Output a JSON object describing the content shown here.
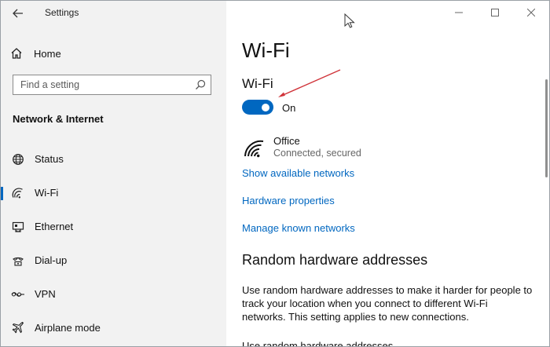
{
  "window": {
    "title": "Settings"
  },
  "sidebar": {
    "home_label": "Home",
    "search_placeholder": "Find a setting",
    "section_heading": "Network & Internet",
    "items": [
      {
        "label": "Status",
        "icon": "globe-icon",
        "active": false
      },
      {
        "label": "Wi-Fi",
        "icon": "wifi-icon",
        "active": true
      },
      {
        "label": "Ethernet",
        "icon": "ethernet-icon",
        "active": false
      },
      {
        "label": "Dial-up",
        "icon": "dialup-icon",
        "active": false
      },
      {
        "label": "VPN",
        "icon": "vpn-icon",
        "active": false
      },
      {
        "label": "Airplane mode",
        "icon": "airplane-icon",
        "active": false
      }
    ]
  },
  "main": {
    "page_title": "Wi-Fi",
    "wifi_section_title": "Wi-Fi",
    "wifi_toggle": {
      "state": "On",
      "on": true
    },
    "network": {
      "name": "Office",
      "status": "Connected, secured"
    },
    "links": [
      "Show available networks",
      "Hardware properties",
      "Manage known networks"
    ],
    "random_section_title": "Random hardware addresses",
    "random_description": "Use random hardware addresses to make it harder for people to track your location when you connect to different Wi-Fi networks. This setting applies to new connections.",
    "cut_off_text": "Use random hardware addresses"
  },
  "colors": {
    "accent": "#0067c0",
    "sidebar_bg": "#f2f2f2",
    "annotation_arrow": "#d0343a"
  }
}
